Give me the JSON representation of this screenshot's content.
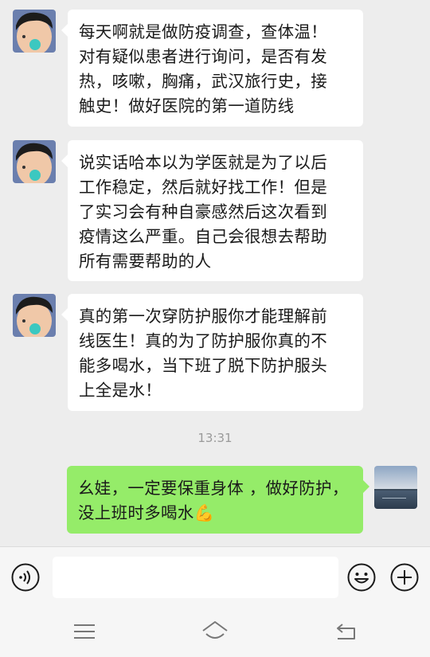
{
  "messages": [
    {
      "direction": "incoming",
      "lines": [
        "每天啊就是做防疫调查，查体温！",
        "对有疑似患者进行询问，是否有发",
        "热，咳嗽，胸痛，武汉旅行史，接",
        "触史！做好医院的第一道防线"
      ]
    },
    {
      "direction": "incoming",
      "lines": [
        "说实话哈本以为学医就是为了以后",
        "工作稳定，然后就好找工作！但是",
        "了实习会有种自豪感然后这次看到",
        "疫情这么严重。自己会很想去帮助",
        "所有需要帮助的人"
      ]
    },
    {
      "direction": "incoming",
      "lines": [
        "真的第一次穿防护服你才能理解前",
        "线医生！真的为了防护服你真的不",
        "能多喝水，当下班了脱下防护服头",
        "上全是水！"
      ]
    }
  ],
  "timestamp": "13:31",
  "outgoing": {
    "lines": [
      "幺娃，一定要保重身体 ，做好防护，",
      "没上班时多喝水"
    ],
    "emoji": "💪"
  },
  "input": {
    "value": ""
  },
  "icons": {
    "voice": "voice-icon",
    "emoji": "emoji-icon",
    "more": "plus-icon",
    "menu": "menu-icon",
    "home": "home-icon",
    "back": "back-icon"
  },
  "colors": {
    "background": "#ededed",
    "outgoing_bubble": "#95ec69",
    "incoming_bubble": "#ffffff"
  }
}
